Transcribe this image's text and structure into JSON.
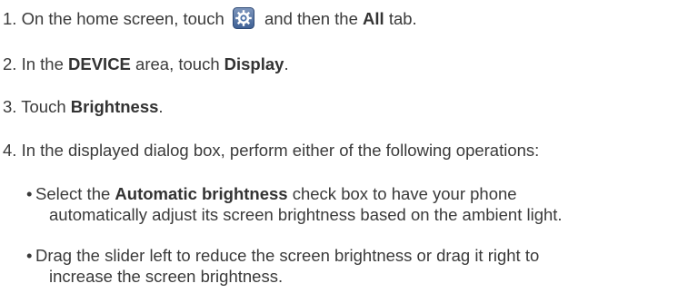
{
  "steps": [
    {
      "num": "1.",
      "text_a": "On the home screen, touch",
      "icon": "settings-gear-icon",
      "text_b": "and then the",
      "bold": "All",
      "text_c": "tab."
    },
    {
      "num": "2.",
      "text_a": "In the",
      "bold_a": "DEVICE",
      "text_b": "area, touch",
      "bold_b": "Display",
      "text_c": "."
    },
    {
      "num": "3.",
      "text_a": "Touch",
      "bold": "Brightness",
      "text_b": "."
    },
    {
      "num": "4.",
      "text": "In the displayed dialog box, perform either of the following operations:"
    }
  ],
  "bullets": [
    {
      "mark": "•",
      "text_a": "Select the",
      "bold": "Automatic brightness",
      "text_b": "check box to have your phone",
      "line2": "automatically adjust its screen brightness based on the ambient light."
    },
    {
      "mark": "•",
      "text_a": "Drag the slider left to reduce the screen brightness or drag it right to",
      "line2": "increase the screen brightness."
    }
  ],
  "colors": {
    "text": "#3a3a3a",
    "icon_bg": "#4a6fa5",
    "icon_fg": "#ffffff"
  }
}
